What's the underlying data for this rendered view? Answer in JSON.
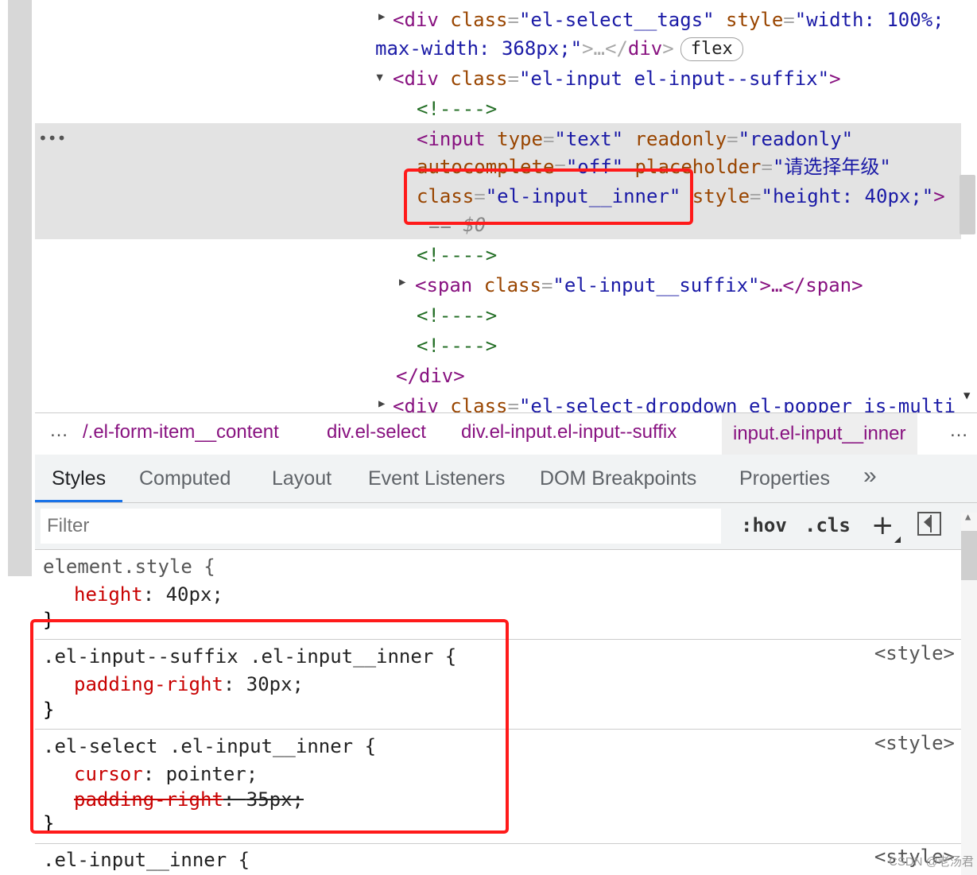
{
  "dom": {
    "line1": {
      "tag_open": "<div ",
      "attr1": "class",
      "eq": "=",
      "val1": "\"el-select__tags\"",
      "attr2": " style",
      "val2": "\"width: 100%;"
    },
    "line2": {
      "val": "max-width: 368px;\"",
      "punc": ">…</",
      "tag": "div",
      "close": ">",
      "badge": "flex"
    },
    "line3": {
      "tag_open": "<div ",
      "attr": "class",
      "eq": "=",
      "val": "\"el-input el-input--suffix\"",
      "close": ">"
    },
    "comment1": "<!---->",
    "input_line1": {
      "tag": "<input ",
      "attr1": "type",
      "val1": "\"text\"",
      "attr2": " readonly",
      "val2": "\"readonly\""
    },
    "input_line2": {
      "attr1": "autocomplete",
      "val1": "\"off\"",
      "attr2": " placeholder",
      "val2": "\"请选择年级\""
    },
    "input_line3": {
      "attr1": "class",
      "val1": "\"el-input__inner\"",
      "attr2": " style",
      "val2": "\"height: 40px;\"",
      "close": ">"
    },
    "dollar": "== $0",
    "comment2": "<!---->",
    "span_line": {
      "tag": "<span ",
      "attr": "class",
      "val": "\"el-input__suffix\"",
      "rest": ">…</span>"
    },
    "comment3": "<!---->",
    "comment4": "<!---->",
    "close_div": "</div>",
    "dropdown_line": {
      "tag": "<div ",
      "attr": "class",
      "val": "\"el-select-dropdown el-popper is-multi"
    },
    "more": "•••"
  },
  "breadcrumb": {
    "dots_left": "…",
    "items": [
      "/.el-form-item__content",
      "div.el-select",
      "div.el-input.el-input--suffix",
      "input.el-input__inner"
    ],
    "dots_right": "…"
  },
  "tabs": [
    "Styles",
    "Computed",
    "Layout",
    "Event Listeners",
    "DOM Breakpoints",
    "Properties",
    "»"
  ],
  "filter": {
    "placeholder": "Filter",
    "hov": ":hov",
    "cls": ".cls",
    "plus": "+"
  },
  "styles": {
    "rule1": {
      "selector": "element.style {",
      "prop": "height",
      "val": "40px;",
      "close": "}"
    },
    "rule2": {
      "selector": ".el-input--suffix .el-input__inner {",
      "prop": "padding-right",
      "val": "30px;",
      "close": "}",
      "source": "<style>"
    },
    "rule3": {
      "selector": ".el-select .el-input__inner {",
      "prop1": "cursor",
      "val1": "pointer;",
      "prop2": "padding-right",
      "val2": "35px;",
      "close": "}",
      "source": "<style>"
    },
    "rule4": {
      "selector": ".el-input__inner {",
      "source": "<style>"
    }
  },
  "watermark": "CSDN @老汤君",
  "colors": {
    "highlight": "#ff1a1a",
    "tab_accent": "#1a73e8",
    "tag": "#881280",
    "attr": "#994500",
    "value": "#1a1aa6",
    "comment": "#236e25",
    "property": "#c80000"
  }
}
